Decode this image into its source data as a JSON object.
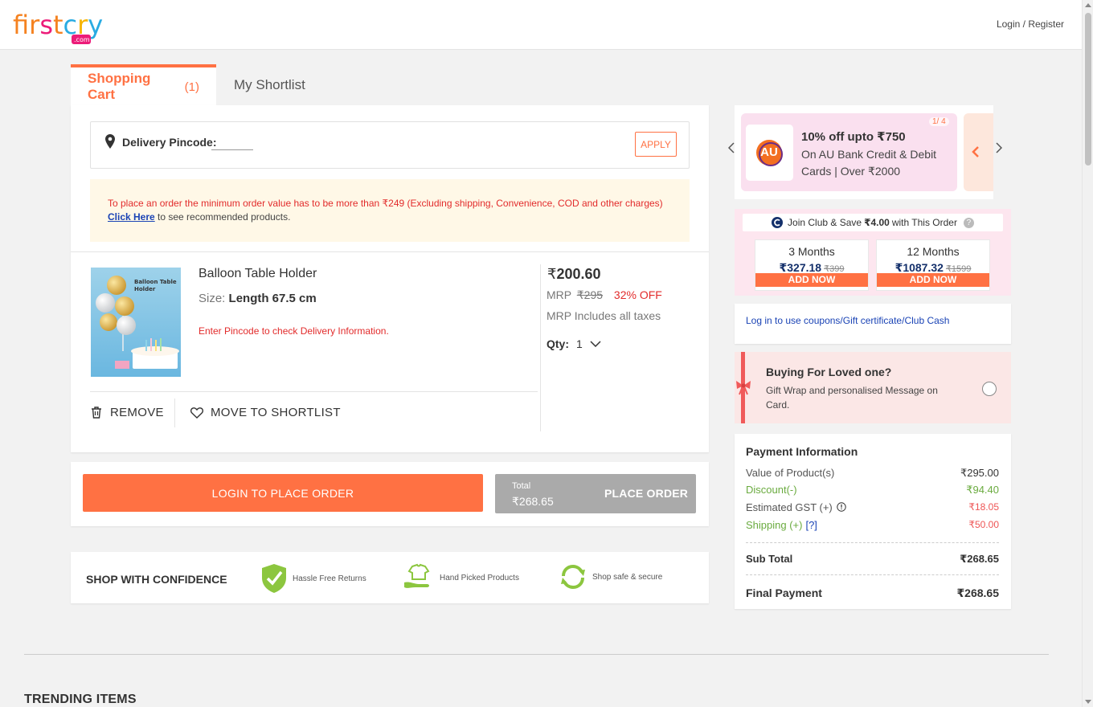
{
  "header": {
    "logo_text": "firstcry",
    "logo_sub": ".com",
    "login_label": "Login / Register"
  },
  "tabs": {
    "cart_label": "Shopping Cart",
    "cart_count": "(1)",
    "shortlist_label": "My Shortlist"
  },
  "pincode": {
    "label": "Delivery Pincode:",
    "value": "",
    "apply_label": "APPLY"
  },
  "notice": {
    "text": "To place an order the minimum order value has to be more than ₹249 (Excluding shipping, Convenience, COD and other charges)",
    "link": "Click Here",
    "tail": " to see recommended products."
  },
  "product": {
    "name": "Balloon Table Holder",
    "size_label": "Size:",
    "size_value": "Length 67.5 cm",
    "pin_msg": "Enter Pincode to check Delivery Information.",
    "image_text": "Balloon Table Holder",
    "price_symbol": "₹",
    "price": "200.60",
    "mrp_label": "MRP",
    "mrp_value": "₹295",
    "discount": "32% OFF",
    "tax_note": "MRP Includes all taxes",
    "qty_label": "Qty:",
    "qty_value": "1",
    "remove_label": "REMOVE",
    "shortlist_label": "MOVE TO SHORTLIST"
  },
  "order": {
    "login_button": "LOGIN TO PLACE ORDER",
    "total_label": "Total",
    "total_value": "₹268.65",
    "place_button": "PLACE ORDER"
  },
  "confidence": {
    "title": "SHOP WITH CONFIDENCE",
    "items": [
      "Hassle Free Returns",
      "Hand Picked Products",
      "Shop safe & secure"
    ]
  },
  "trending": {
    "title": "TRENDING ITEMS"
  },
  "offer": {
    "pager": "1/ 4",
    "title": "10% off upto ₹750",
    "desc": "On AU Bank Credit & Debit Cards | Over ₹2000",
    "logo": "AU"
  },
  "club": {
    "head_pre": "Join Club & Save",
    "head_amount": "₹4.00",
    "head_post": "with This Order",
    "help": "?",
    "plans": [
      {
        "name": "3 Months",
        "price": "₹327.18",
        "mrp": "₹399",
        "cta": "ADD NOW"
      },
      {
        "name": "12 Months",
        "price": "₹1087.32",
        "mrp": "₹1599",
        "cta": "ADD NOW"
      }
    ]
  },
  "coupon": {
    "link": "Log in to use coupons/Gift certificate/Club Cash"
  },
  "gift": {
    "title": "Buying For Loved one?",
    "desc": "Gift Wrap and personalised Message on Card."
  },
  "payment": {
    "title": "Payment Information",
    "rows": [
      {
        "label": "Value of Product(s)",
        "value": "₹295.00"
      },
      {
        "label": "Discount(-)",
        "value": "₹94.40"
      },
      {
        "label": "Estimated GST (+)",
        "value": "₹18.05"
      },
      {
        "label": "Shipping (+)",
        "help": "[?]",
        "value": "₹50.00"
      }
    ],
    "subtotal_label": "Sub Total",
    "subtotal_value": "₹268.65",
    "final_label": "Final Payment",
    "final_value": "₹268.65"
  },
  "colors": {
    "accent": "#ff7143",
    "link": "#1a43b5",
    "error": "#e22b2b",
    "success": "#6aab3f"
  }
}
